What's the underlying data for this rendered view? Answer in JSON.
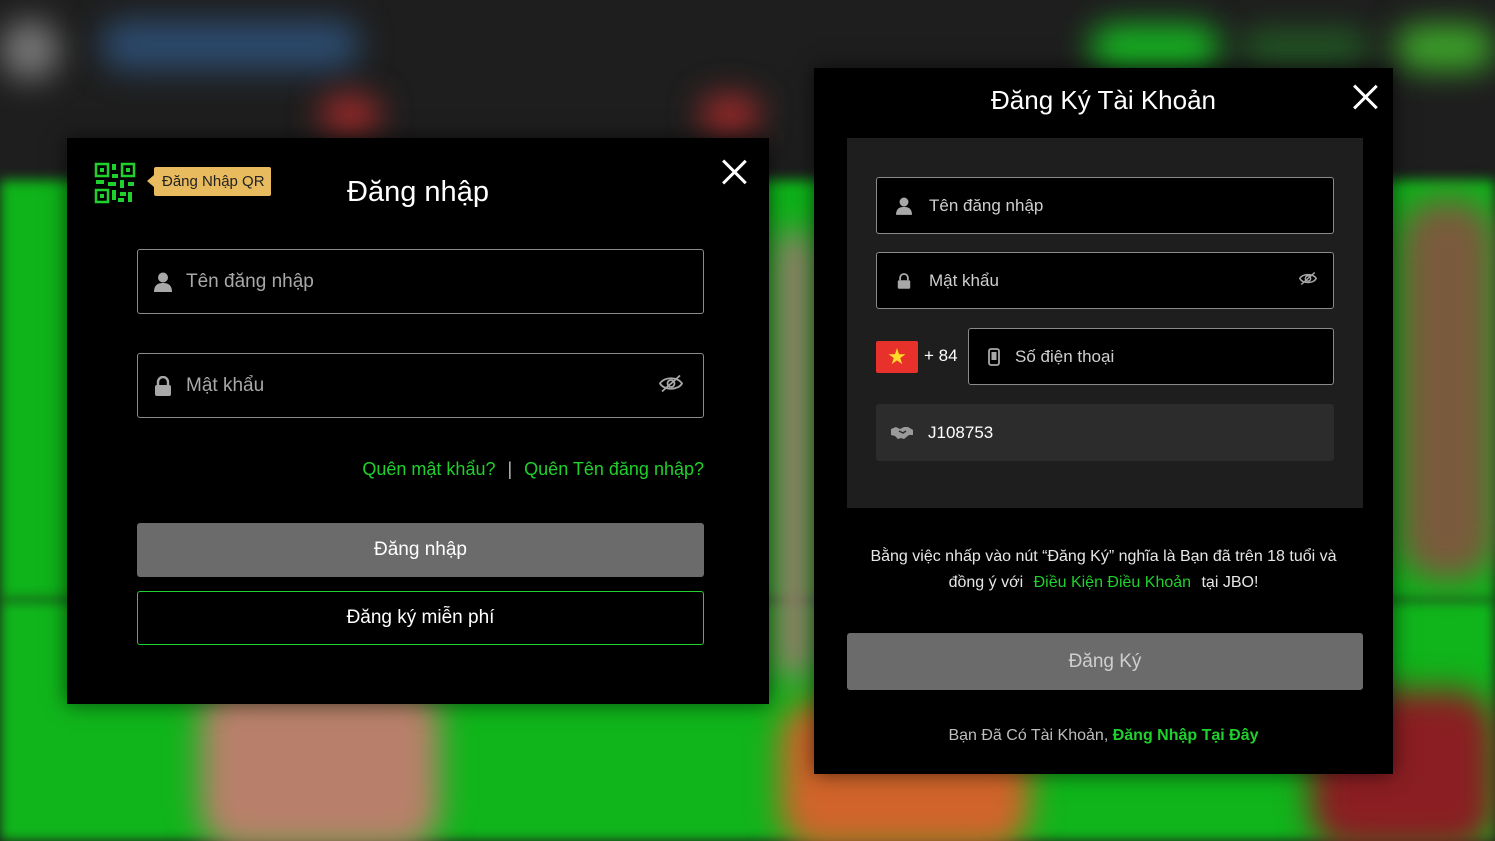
{
  "login_modal": {
    "qr_badge": "Đăng Nhập QR",
    "title": "Đăng nhập",
    "username_placeholder": "Tên đăng nhập",
    "password_placeholder": "Mật khẩu",
    "forgot_password": "Quên mật khẩu?",
    "separator": "|",
    "forgot_username": "Quên Tên đăng nhập?",
    "login_button": "Đăng nhập",
    "register_free_button": "Đăng ký miễn phí"
  },
  "register_modal": {
    "title": "Đăng Ký Tài Khoản",
    "username_placeholder": "Tên đăng nhập",
    "password_placeholder": "Mật khẩu",
    "flag_icon": "vietnam-flag",
    "country_code": "+ 84",
    "phone_placeholder": "Số điện thoại",
    "referral_code": "J108753",
    "terms_line1": "Bằng việc nhấp vào nút “Đăng Ký” nghĩa là Bạn đã trên 18 tuổi và",
    "terms_line2_prefix": "đồng ý với",
    "terms_link": "Điều Kiện Điều Khoản",
    "terms_line2_suffix": "tại JBO!",
    "register_button": "Đăng Ký",
    "have_account_text": "Bạn Đã Có Tài Khoản,",
    "login_here_link": "Đăng Nhập Tại Đây"
  },
  "colors": {
    "accent_green": "#1fd12c",
    "qr_badge_bg": "#e8bb5e",
    "button_gray": "#6b6b6b",
    "modal_bg": "#000000",
    "panel_bg": "#1e1e1e"
  }
}
